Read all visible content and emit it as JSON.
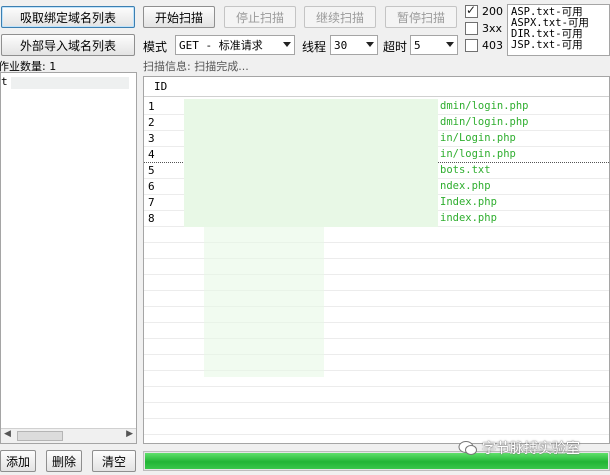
{
  "toolbar": {
    "load_bound_domains": "吸取绑定域名列表",
    "import_domains": "外部导入域名列表",
    "start_scan": "开始扫描",
    "stop_scan": "停止扫描",
    "continue_scan": "继续扫描",
    "pause_scan": "暂停扫描"
  },
  "settings": {
    "mode_label": "模式",
    "mode_value": "GET - 标准请求",
    "threads_label": "线程",
    "threads_value": "30",
    "timeout_label": "超时",
    "timeout_value": "5"
  },
  "status_filters": [
    {
      "label": "200",
      "checked": true
    },
    {
      "label": "3xx",
      "checked": false
    },
    {
      "label": "403",
      "checked": false
    }
  ],
  "dictionaries": [
    "ASP.txt-可用",
    "ASPX.txt-可用",
    "DIR.txt-可用",
    "JSP.txt-可用"
  ],
  "left_panel": {
    "job_count_label": "作业数量: 1",
    "first_item": "t"
  },
  "scan_info": "扫描信息: 扫描完成...",
  "results": {
    "id_header": "ID",
    "rows": [
      {
        "id": "1",
        "url": "dmin/login.php"
      },
      {
        "id": "2",
        "url": "dmin/login.php"
      },
      {
        "id": "3",
        "url": "in/Login.php"
      },
      {
        "id": "4",
        "url": "in/login.php"
      },
      {
        "id": "5",
        "url": "bots.txt"
      },
      {
        "id": "6",
        "url": "ndex.php"
      },
      {
        "id": "7",
        "url": "Index.php"
      },
      {
        "id": "8",
        "url": "index.php"
      }
    ]
  },
  "bottom_buttons": {
    "add": "添加",
    "delete": "删除",
    "clear": "清空"
  },
  "progress": {
    "fraction": 1.0,
    "color": "#22b535"
  },
  "watermark": "字节脉搏实验室",
  "colors": {
    "url_green": "#2fae2f",
    "accent_blue": "#3c7fb1"
  }
}
